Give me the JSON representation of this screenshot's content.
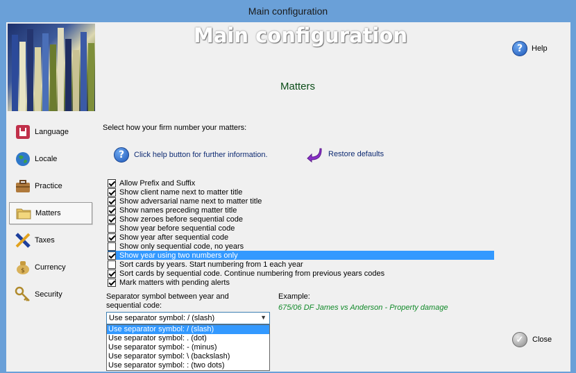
{
  "window": {
    "title": "Main configuration"
  },
  "header": {
    "big_title": "Main configuration",
    "help_label": "Help",
    "section_title": "Matters"
  },
  "nav": {
    "items": [
      {
        "label": "Language",
        "icon": "language-icon",
        "active": false
      },
      {
        "label": "Locale",
        "icon": "globe-icon",
        "active": false
      },
      {
        "label": "Practice",
        "icon": "briefcase-icon",
        "active": false
      },
      {
        "label": "Matters",
        "icon": "folder-icon",
        "active": true
      },
      {
        "label": "Taxes",
        "icon": "taxes-icon",
        "active": false
      },
      {
        "label": "Currency",
        "icon": "money-bag-icon",
        "active": false
      },
      {
        "label": "Security",
        "icon": "keys-icon",
        "active": false
      }
    ]
  },
  "main": {
    "intro": "Select how your firm number your matters:",
    "help_link": "Click help button for further information.",
    "restore_label": "Restore defaults",
    "options": [
      {
        "label": "Allow Prefix and Suffix",
        "checked": true,
        "selected": false
      },
      {
        "label": "Show client name next to matter title",
        "checked": true,
        "selected": false
      },
      {
        "label": "Show adversarial name next to matter title",
        "checked": true,
        "selected": false
      },
      {
        "label": "Show names preceding matter title",
        "checked": true,
        "selected": false
      },
      {
        "label": "Show zeroes before sequential code",
        "checked": true,
        "selected": false
      },
      {
        "label": "Show year before sequential code",
        "checked": false,
        "selected": false
      },
      {
        "label": "Show year after sequential code",
        "checked": true,
        "selected": false
      },
      {
        "label": "Show only sequential code, no years",
        "checked": false,
        "selected": false
      },
      {
        "label": "Show year using two numbers only",
        "checked": true,
        "selected": true
      },
      {
        "label": "Sort cards by years. Start numbering from 1 each year",
        "checked": false,
        "selected": false
      },
      {
        "label": "Sort cards by sequential code. Continue numbering from previous years codes",
        "checked": true,
        "selected": false
      },
      {
        "label": "Mark matters with pending alerts",
        "checked": true,
        "selected": false
      }
    ],
    "separator": {
      "label": "Separator symbol between year and sequential code:",
      "value": "Use separator symbol: / (slash)",
      "options": [
        "Use separator symbol: / (slash)",
        "Use separator symbol: . (dot)",
        "Use separator symbol: - (minus)",
        "Use separator symbol: \\ (backslash)",
        "Use separator symbol:  : (two dots)"
      ],
      "highlighted_index": 0
    },
    "example": {
      "label": "Example:",
      "value": "675/06 DF James vs Anderson - Property damage"
    },
    "close_label": "Close"
  },
  "colors": {
    "accent": "#3399ff",
    "section_title": "#0b4c18",
    "example_text": "#128a2a",
    "titlebar": "#6aa0d8"
  }
}
